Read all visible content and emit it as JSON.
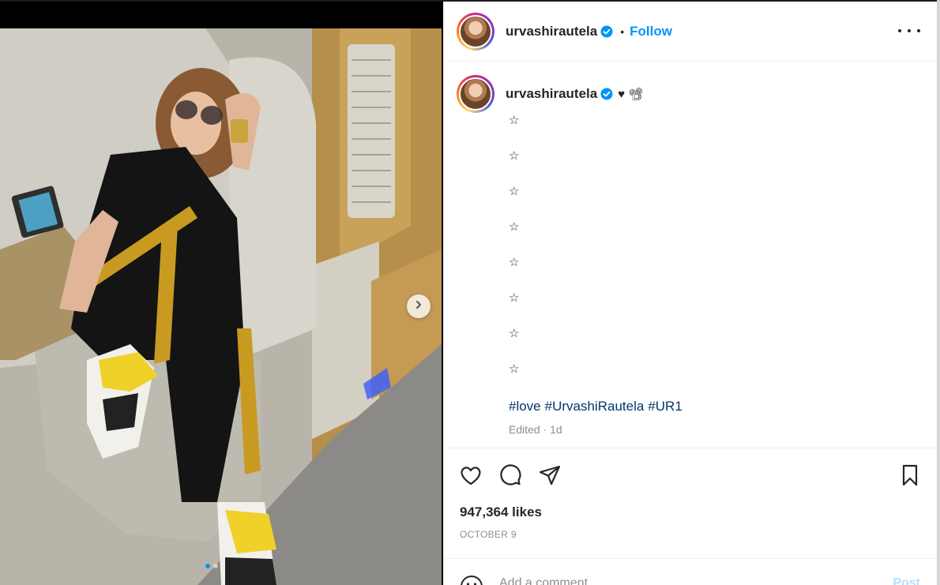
{
  "post": {
    "username": "urvashirautela",
    "follow_label": "Follow",
    "separator": "•",
    "caption_emojis": "♥ 📽",
    "caption_lines": [
      "☆",
      "☆",
      "☆",
      "☆",
      "☆",
      "☆",
      "☆",
      "☆"
    ],
    "hashtags": [
      "#love",
      "#UrvashiRautela",
      "#UR1"
    ],
    "edited": "Edited · 1d",
    "likes": "947,364 likes",
    "date": "OCTOBER 9",
    "comment_placeholder": "Add a comment...",
    "post_label": "Post"
  },
  "colors": {
    "link_blue": "#0095f6",
    "hashtag_blue": "#00376b",
    "muted": "#8e8e8e",
    "post_disabled": "#b2dffc"
  },
  "icons": [
    "verified-badge-icon",
    "more-options-icon",
    "heart-icon",
    "comment-icon",
    "share-icon",
    "bookmark-icon",
    "emoji-icon",
    "chevron-right-icon"
  ]
}
